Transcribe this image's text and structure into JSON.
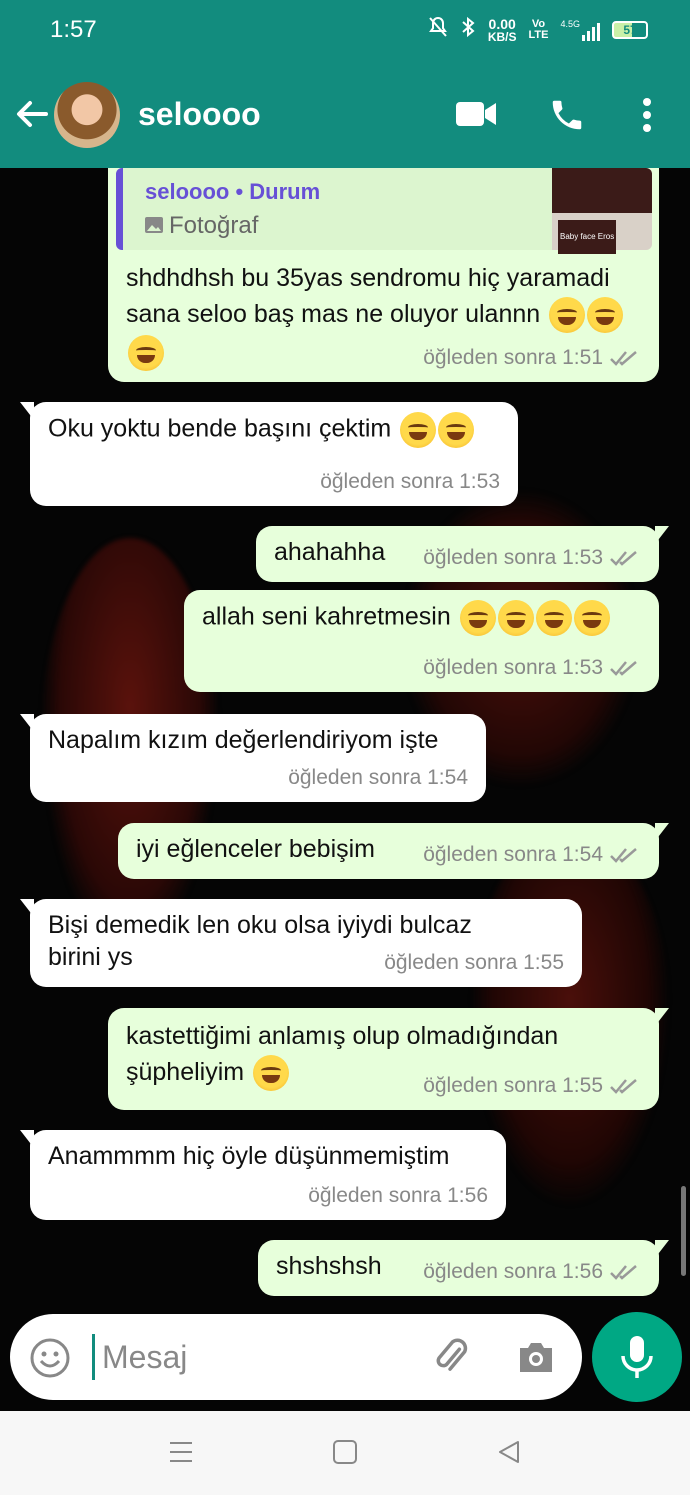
{
  "status": {
    "time": "1:57",
    "speed_value": "0.00",
    "speed_unit": "KB/S",
    "net_top": "Vo",
    "net_bottom": "LTE",
    "signal": "4.5G",
    "battery": "57"
  },
  "header": {
    "contact_name": "seloooo"
  },
  "icons": {
    "back": "arrow-left-icon",
    "video": "video-camera-icon",
    "call": "phone-icon",
    "menu": "more-vert-icon",
    "emoji": "emoji-icon",
    "attach": "paperclip-icon",
    "camera": "camera-icon",
    "mic": "microphone-icon",
    "read": "double-check-icon"
  },
  "reply": {
    "author": "seloooo • Durum",
    "type": "Fotoğraf",
    "thumb_caption": "Baby face Eros"
  },
  "messages": [
    {
      "dir": "out",
      "text": "shdhdhsh bu 35yas sendromu hiç yaramadi sana seloo baş mas ne oluyor ulannn",
      "emoji_count": 3,
      "time": "öğleden sonra 1:51"
    },
    {
      "dir": "in",
      "text": "Oku yoktu bende başını çektim",
      "emoji_count": 2,
      "time": "öğleden sonra 1:53"
    },
    {
      "dir": "out",
      "text": "ahahahha",
      "emoji_count": 0,
      "time": "öğleden sonra 1:53"
    },
    {
      "dir": "out",
      "text": "allah seni kahretmesin",
      "emoji_count": 4,
      "time": "öğleden sonra 1:53"
    },
    {
      "dir": "in",
      "text": "Napalım kızım değerlendiriyom işte",
      "emoji_count": 0,
      "time": "öğleden sonra 1:54"
    },
    {
      "dir": "out",
      "text": "iyi eğlenceler bebişim",
      "emoji_count": 0,
      "time": "öğleden sonra 1:54"
    },
    {
      "dir": "in",
      "text": "Bişi demedik len oku olsa iyiydi bulcaz birini ys",
      "emoji_count": 0,
      "time": "öğleden sonra 1:55"
    },
    {
      "dir": "out",
      "text": "kastettiğimi anlamış olup olmadığından şüpheliyim",
      "emoji_count": 1,
      "time": "öğleden sonra 1:55"
    },
    {
      "dir": "in",
      "text": "Anammmm hiç öyle düşünmemiştim",
      "emoji_count": 0,
      "time": "öğleden sonra 1:56"
    },
    {
      "dir": "out",
      "text": "shshshsh",
      "emoji_count": 0,
      "time": "öğleden sonra 1:56"
    }
  ],
  "composer": {
    "placeholder": "Mesaj"
  },
  "colors": {
    "header": "#128C7E",
    "outgoing": "#E7FFDB",
    "incoming": "#FFFFFF",
    "accent": "#00A884",
    "reply_bar": "#6750d6"
  }
}
